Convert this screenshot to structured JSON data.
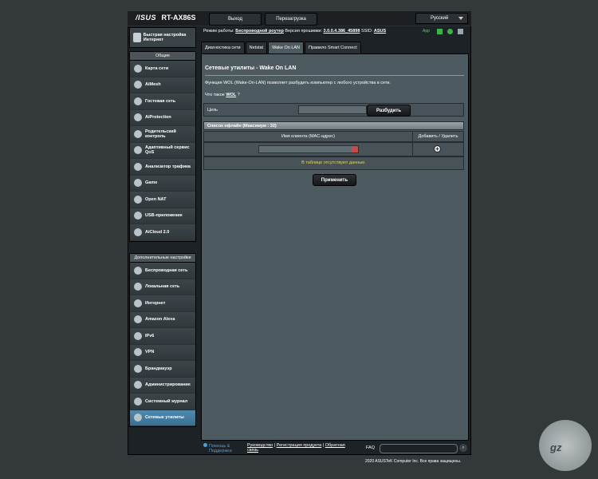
{
  "header": {
    "brand": "/ISUS",
    "model": "RT-AX86S",
    "logout": "Выход",
    "reboot": "Перезагрузка",
    "language": "Русский"
  },
  "status": {
    "mode_label": "Режим работы:",
    "mode_value": "Беспроводной роутер",
    "fw_label": "Версия прошивки:",
    "fw_value": "3.0.0.4.386_45898",
    "ssid_label": "SSID:",
    "ssid_value": "ASUS",
    "app_label": "App"
  },
  "quick_setup": {
    "label": "Быстрая настройка Интернет"
  },
  "general": {
    "title": "Общие",
    "items": [
      {
        "label": "Карта сети"
      },
      {
        "label": "AiMesh"
      },
      {
        "label": "Гостевая сеть"
      },
      {
        "label": "AiProtection"
      },
      {
        "label": "Родительский контроль"
      },
      {
        "label": "Адаптивный сервис QoS"
      },
      {
        "label": "Анализатор трафика"
      },
      {
        "label": "Game"
      },
      {
        "label": "Open NAT"
      },
      {
        "label": "USB-приложение"
      },
      {
        "label": "AiCloud 2.0"
      }
    ]
  },
  "advanced": {
    "title": "Дополнительные настройки",
    "items": [
      {
        "label": "Беспроводная сеть"
      },
      {
        "label": "Локальная сеть"
      },
      {
        "label": "Интернет"
      },
      {
        "label": "Amazon Alexa"
      },
      {
        "label": "IPv6"
      },
      {
        "label": "VPN"
      },
      {
        "label": "Брандмауэр"
      },
      {
        "label": "Администрирование"
      },
      {
        "label": "Системный журнал"
      },
      {
        "label": "Сетевые утилиты"
      }
    ]
  },
  "tabs": [
    {
      "label": "Диагностика сети"
    },
    {
      "label": "Netstat"
    },
    {
      "label": "Wake On LAN"
    },
    {
      "label": "Правило Smart Connect"
    }
  ],
  "main": {
    "title": "Сетевые утилиты - Wake On LAN",
    "description": "Функция WOL (Wake-On-LAN) позволяет разбудить компьютер с любого устройства в сети.",
    "what_is": "Что такое",
    "wol_link": "WOL",
    "what_is_q": "?",
    "target_label": "Цель",
    "wake_button": "Разбудить",
    "list_header": "Список офлайн (Максимум : 32)",
    "col_client": "Имя клиента (MAC-адрес)",
    "col_action": "Добавить / Удалить",
    "empty_text": "В таблице отсутствуют данные.",
    "apply_button": "Применить"
  },
  "footer": {
    "help": "Помощь &",
    "help2": "Поддержка",
    "manual": "Руководство",
    "register": "Регистрация продукта",
    "feedback": "Обратная",
    "feedback2": "связь",
    "faq": "FAQ",
    "copyright": "2020 ASUSTeK Computer Inc. Все права защищены."
  },
  "watermark": {
    "text": "gz"
  }
}
